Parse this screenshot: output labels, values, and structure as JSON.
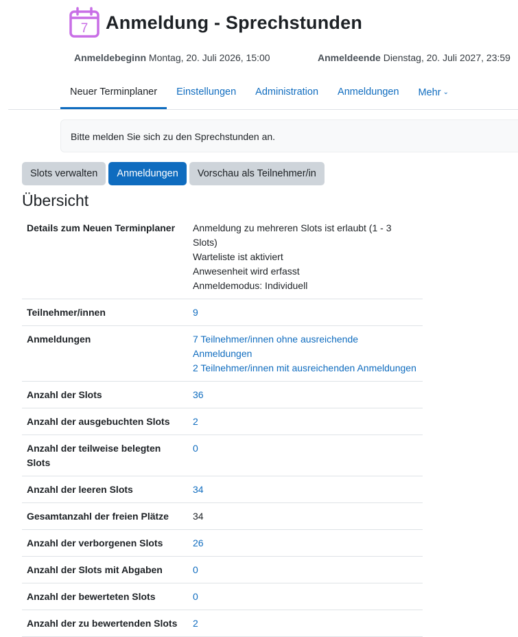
{
  "header": {
    "title": "Anmeldung - Sprechstunden",
    "icon": "calendar-icon",
    "icon_day": "7",
    "icon_color": "#c86ee6"
  },
  "dates": {
    "begin_label": "Anmeldebeginn",
    "begin_value": "Montag, 20. Juli 2026, 15:00",
    "end_label": "Anmeldeende",
    "end_value": "Dienstag, 20. Juli 2027, 23:59"
  },
  "tabs": [
    {
      "label": "Neuer Terminplaner",
      "active": true
    },
    {
      "label": "Einstellungen"
    },
    {
      "label": "Administration"
    },
    {
      "label": "Anmeldungen"
    },
    {
      "label": "Mehr"
    }
  ],
  "intro": "Bitte melden Sie sich zu den Sprechstunden an.",
  "actions": {
    "manage_slots": "Slots verwalten",
    "registrations": "Anmeldungen",
    "preview": "Vorschau als Teilnehmer/in"
  },
  "overview": {
    "title": "Übersicht",
    "details_label": "Details zum Neuen Terminplaner",
    "details": [
      "Anmeldung zu mehreren Slots ist erlaubt (1 - 3 Slots)",
      "Warteliste ist aktiviert",
      "Anwesenheit wird erfasst",
      "Anmeldemodus: Individuell"
    ],
    "participants_label": "Teilnehmer/innen",
    "participants_value": "9",
    "registrations_label": "Anmeldungen",
    "registrations_links": [
      "7 Teilnehmer/innen ohne ausreichende Anmeldungen",
      "2 Teilnehmer/innen mit ausreichenden Anmeldungen"
    ],
    "rows": [
      {
        "label": "Anzahl der Slots",
        "value": "36",
        "link": true
      },
      {
        "label": "Anzahl der ausgebuchten Slots",
        "value": "2",
        "link": true
      },
      {
        "label": "Anzahl der teilweise belegten Slots",
        "value": "0",
        "link": true
      },
      {
        "label": "Anzahl der leeren Slots",
        "value": "34",
        "link": true
      },
      {
        "label": "Gesamtanzahl der freien Plätze",
        "value": "34",
        "link": false
      },
      {
        "label": "Anzahl der verborgenen Slots",
        "value": "26",
        "link": true
      },
      {
        "label": "Anzahl der Slots mit Abgaben",
        "value": "0",
        "link": true
      },
      {
        "label": "Anzahl der bewerteten Slots",
        "value": "0",
        "link": true
      },
      {
        "label": "Anzahl der zu bewertenden Slots",
        "value": "2",
        "link": true
      }
    ]
  }
}
